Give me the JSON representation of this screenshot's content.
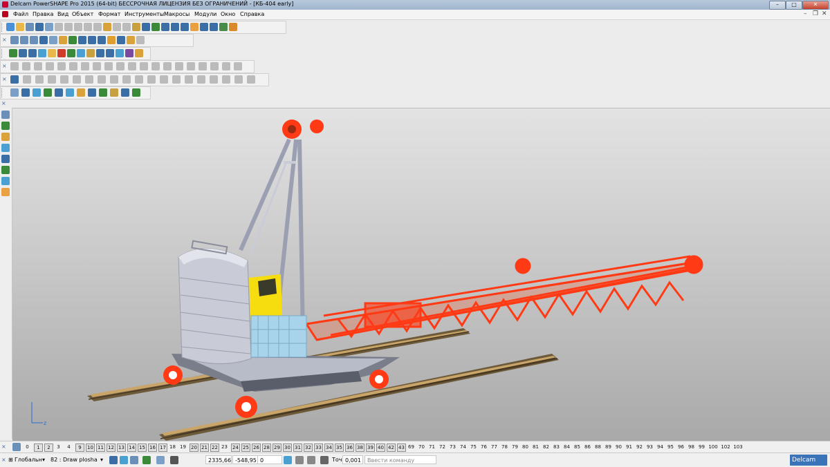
{
  "window": {
    "title": "Delcam PowerSHAPE Pro 2015 (64-bit) БЕССРОЧНАЯ ЛИЦЕНЗИЯ БЕЗ ОГРАНИЧЕНИЙ - [КБ-404 early]",
    "min_label": "–",
    "max_label": "□",
    "close_label": "✕",
    "mdi_min": "–",
    "mdi_restore": "❐",
    "mdi_close": "✕"
  },
  "menu": [
    "Файл",
    "Правка",
    "Вид",
    "Объект",
    "Формат",
    "Инструменты",
    "Макросы",
    "Модули",
    "Окно",
    "Справка"
  ],
  "toolbars": {
    "close_label": "×",
    "rows": [
      {
        "icons": [
          "#4a90d9",
          "#e8b84a",
          "#6a8fb8",
          "#3a6ea5",
          "#7aa0c8",
          "#bbbbbb",
          "#bbbbbb",
          "#bbbbbb",
          "#bbbbbb",
          "#bbbbbb",
          "#d9a23a",
          "#bbbbbb",
          "#bbbbbb",
          "#c8a040",
          "#3a6ea5",
          "#3a8a3a",
          "#3a6ea5",
          "#3a6ea5",
          "#3a6ea5",
          "#e8a040",
          "#3a6ea5",
          "#3a6ea5",
          "#4a8a4a",
          "#d88a2a"
        ]
      },
      {
        "icons": [
          "#6a8fb8",
          "#6a8fb8",
          "#6a8fb8",
          "#3a6ea5",
          "#7aa0c8",
          "#d9a23a",
          "#3a8a3a",
          "#3a6ea5",
          "#3a6ea5",
          "#3a6ea5",
          "#e0a030",
          "#3a6ea5",
          "#d9a23a",
          "#bbbbbb"
        ]
      },
      {
        "icons": [
          "#3a8a3a",
          "#3a6ea5",
          "#3a6ea5",
          "#4aa0d0",
          "#e8b84a",
          "#d03a2a",
          "#3a8a3a",
          "#4aa0d0",
          "#c8a040",
          "#3a6ea5",
          "#3a6ea5",
          "#4aa0d0",
          "#7a4aa0",
          "#d9a23a"
        ]
      },
      {
        "icons": [
          "#bbbbbb",
          "#bbbbbb",
          "#bbbbbb",
          "#bbbbbb",
          "#bbbbbb",
          "#bbbbbb",
          "#bbbbbb",
          "#bbbbbb",
          "#bbbbbb",
          "#bbbbbb",
          "#bbbbbb",
          "#bbbbbb",
          "#bbbbbb",
          "#bbbbbb",
          "#bbbbbb",
          "#bbbbbb",
          "#bbbbbb",
          "#bbbbbb",
          "#bbbbbb",
          "#bbbbbb"
        ]
      },
      {
        "icons": [
          "#3a6ea5",
          "#bbbbbb",
          "#bbbbbb",
          "#bbbbbb",
          "#bbbbbb",
          "#bbbbbb",
          "#bbbbbb",
          "#bbbbbb",
          "#bbbbbb",
          "#bbbbbb",
          "#bbbbbb",
          "#bbbbbb",
          "#bbbbbb",
          "#bbbbbb",
          "#bbbbbb",
          "#bbbbbb",
          "#bbbbbb",
          "#bbbbbb",
          "#bbbbbb",
          "#bbbbbb"
        ]
      },
      {
        "icons": [
          "#7aa0c8",
          "#3a6ea5",
          "#4aa0d0",
          "#3a8a3a",
          "#3a6ea5",
          "#4aa0d0",
          "#d9a23a",
          "#3a6ea5",
          "#3a8a3a",
          "#c8a040",
          "#3a6ea5",
          "#3a8a3a"
        ]
      }
    ]
  },
  "sidebar": {
    "close_label": "×",
    "icons": [
      "#6a8fb8",
      "#3a8a3a",
      "#d9a23a",
      "#4aa0d0",
      "#3a6ea5",
      "#3a8a3a",
      "#4aa0d0",
      "#e8a040"
    ]
  },
  "viewport": {
    "axis_label": "z",
    "colors": {
      "boom": "#ff3a14",
      "structure": "#c9ccd8",
      "cab": "#f6dd10",
      "engine": "#a9d3ea",
      "rail": "#8a6a3a"
    }
  },
  "levels": {
    "close_label": "×",
    "items": [
      {
        "label": "0",
        "on": false
      },
      {
        "label": "1",
        "on": true
      },
      {
        "label": "2",
        "on": true
      },
      {
        "label": "3",
        "on": false
      },
      {
        "label": "4",
        "on": false
      },
      {
        "label": "9",
        "on": true
      },
      {
        "label": "10",
        "on": true
      },
      {
        "label": "11",
        "on": true
      },
      {
        "label": "12",
        "on": true
      },
      {
        "label": "13",
        "on": true
      },
      {
        "label": "14",
        "on": true
      },
      {
        "label": "15",
        "on": true
      },
      {
        "label": "16",
        "on": true
      },
      {
        "label": "17",
        "on": true
      },
      {
        "label": "18",
        "on": false
      },
      {
        "label": "19",
        "on": false
      },
      {
        "label": "20",
        "on": true
      },
      {
        "label": "21",
        "on": true
      },
      {
        "label": "22",
        "on": true
      },
      {
        "label": "23",
        "on": false
      },
      {
        "label": "24",
        "on": true
      },
      {
        "label": "25",
        "on": true
      },
      {
        "label": "26",
        "on": true
      },
      {
        "label": "28",
        "on": true
      },
      {
        "label": "29",
        "on": true
      },
      {
        "label": "30",
        "on": true
      },
      {
        "label": "31",
        "on": true
      },
      {
        "label": "32",
        "on": true
      },
      {
        "label": "33",
        "on": true
      },
      {
        "label": "34",
        "on": true
      },
      {
        "label": "35",
        "on": true
      },
      {
        "label": "36",
        "on": true
      },
      {
        "label": "38",
        "on": true
      },
      {
        "label": "39",
        "on": true
      },
      {
        "label": "40",
        "on": true
      },
      {
        "label": "42",
        "on": true
      },
      {
        "label": "43",
        "on": true
      },
      {
        "label": "69",
        "on": false
      },
      {
        "label": "70",
        "on": false
      },
      {
        "label": "71",
        "on": false
      },
      {
        "label": "72",
        "on": false
      },
      {
        "label": "73",
        "on": false
      },
      {
        "label": "74",
        "on": false
      },
      {
        "label": "75",
        "on": false
      },
      {
        "label": "76",
        "on": false
      },
      {
        "label": "77",
        "on": false
      },
      {
        "label": "78",
        "on": false
      },
      {
        "label": "79",
        "on": false
      },
      {
        "label": "80",
        "on": false
      },
      {
        "label": "81",
        "on": false
      },
      {
        "label": "82",
        "on": false
      },
      {
        "label": "83",
        "on": false
      },
      {
        "label": "84",
        "on": false
      },
      {
        "label": "85",
        "on": false
      },
      {
        "label": "86",
        "on": false
      },
      {
        "label": "88",
        "on": false
      },
      {
        "label": "89",
        "on": false
      },
      {
        "label": "90",
        "on": false
      },
      {
        "label": "91",
        "on": false
      },
      {
        "label": "92",
        "on": false
      },
      {
        "label": "93",
        "on": false
      },
      {
        "label": "94",
        "on": false
      },
      {
        "label": "95",
        "on": false
      },
      {
        "label": "96",
        "on": false
      },
      {
        "label": "98",
        "on": false
      },
      {
        "label": "99",
        "on": false
      },
      {
        "label": "100",
        "on": false
      },
      {
        "label": "102",
        "on": false
      },
      {
        "label": "103",
        "on": false
      }
    ]
  },
  "status": {
    "workplane": "Глобальн",
    "level_select": "82 : Draw plosha",
    "x": "2335,66",
    "y": "-548,95",
    "z": "0",
    "tol_label": "Точ",
    "tol_value": "0,001",
    "command_placeholder": "Ввести команду",
    "brand": "Delcam"
  }
}
